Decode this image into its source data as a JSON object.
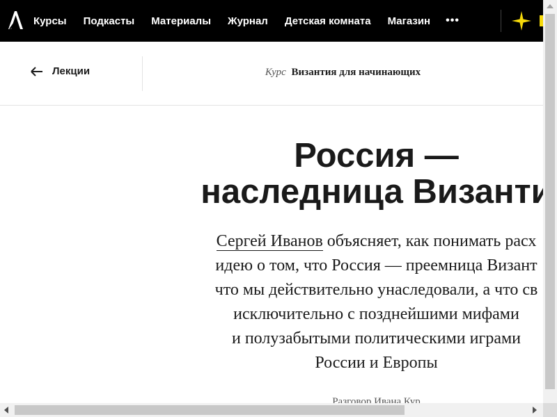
{
  "nav": {
    "logo_icon": "arzamas-logo-icon",
    "items": [
      {
        "label": "Курсы"
      },
      {
        "label": "Подкасты"
      },
      {
        "label": "Материалы"
      },
      {
        "label": "Журнал"
      },
      {
        "label": "Детская комната"
      },
      {
        "label": "Магазин"
      }
    ],
    "more_label": "•••",
    "accent_icon": "sparkle-star-icon",
    "accent_color": "#f5d90a"
  },
  "course_header": {
    "back_label": "Лекции",
    "back_icon": "arrow-left-icon",
    "course_kind": "Курс",
    "course_name": "Византия для начинающих"
  },
  "lecture": {
    "title_line1": "Россия —",
    "title_line2": "наследница Византи",
    "lead": {
      "author_link": "Сергей Иванов",
      "line1_rest": " объясняет, как понимать расх",
      "line2": "идею о том, что Россия — преемница Визант",
      "line3": "что мы действительно унаследовали, а что св",
      "line4": "исключительно с позднейшими мифами",
      "line5": "и полузабытыми политическими играми",
      "line6": "России и Европы"
    },
    "byline": "Разговор Ивана Кур"
  }
}
